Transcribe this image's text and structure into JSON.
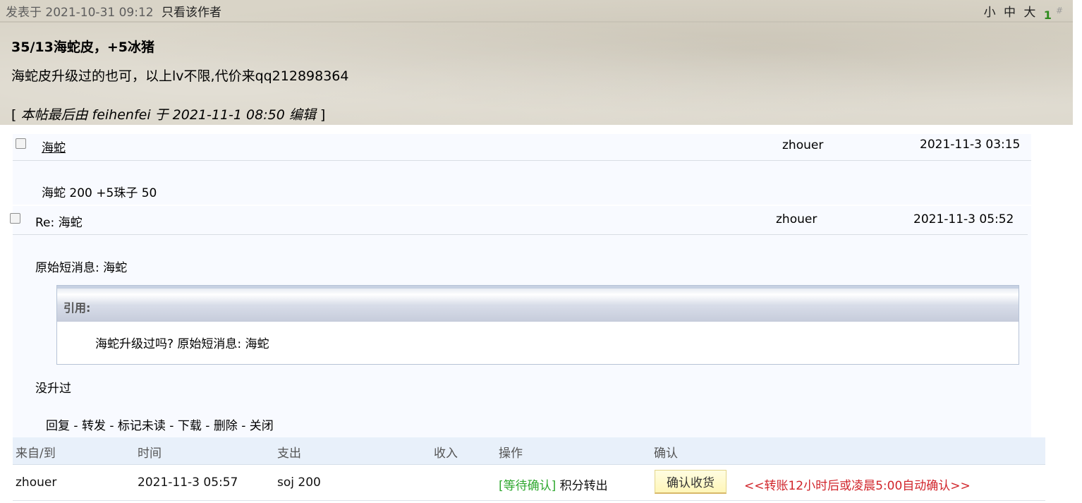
{
  "post": {
    "posted_prefix": "发表于",
    "posted_time": "2021-10-31 09:12",
    "author_only": "只看该作者",
    "font_small": "小",
    "font_medium": "中",
    "font_large": "大",
    "floor_number": "1",
    "floor_hash": "#",
    "title": "35/13海蛇皮，+5冰猪",
    "body": "海蛇皮升级过的也可，以上lv不限,代价来qq212898364",
    "edit_open": "[",
    "edit_note": "本帖最后由 feihenfei 于 2021-11-1 08:50 编辑",
    "edit_close": "]"
  },
  "messages": [
    {
      "subject": "海蛇",
      "sender": "zhouer",
      "time": "2021-11-3 03:15",
      "body": "海蛇 200 +5珠子 50"
    },
    {
      "subject": "Re: 海蛇",
      "sender": "zhouer",
      "time": "2021-11-3 05:52",
      "original": "原始短消息: 海蛇",
      "quote_label": "引用:",
      "quote_text": "海蛇升级过吗? 原始短消息: 海蛇",
      "reply": "没升过"
    }
  ],
  "actions": {
    "reply": "回复",
    "forward": "转发",
    "mark_unread": "标记未读",
    "download": "下载",
    "delete": "删除",
    "close": "关闭",
    "separator": " - "
  },
  "transactions": {
    "headers": {
      "from_to": "来自/到",
      "time": "时间",
      "expense": "支出",
      "income": "收入",
      "operation": "操作",
      "confirm": "确认"
    },
    "rows": [
      {
        "from_to": "zhouer",
        "time": "2021-11-3 05:57",
        "expense": "soj 200",
        "income": "",
        "status": "[等待确认]",
        "operation": "积分转出",
        "confirm_button": "确认收货",
        "auto_note": "<<转账12小时后或凌晨5:00自动确认>>"
      }
    ]
  },
  "colors": {
    "waiting_status": "#2fa82f",
    "auto_note": "#d1252b",
    "floor_number": "#2e8b1e",
    "table_header_bg": "#e8f0fa"
  }
}
